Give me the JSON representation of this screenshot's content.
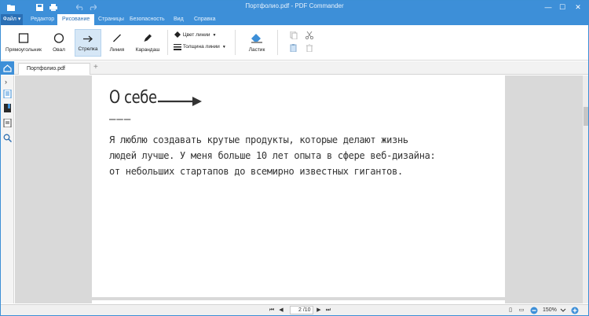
{
  "window": {
    "title": "Портфолио.pdf - PDF Commander",
    "accent": "#3d8fd8"
  },
  "menu": {
    "file": "Файл",
    "tabs": [
      "Редактор",
      "Рисование",
      "Страницы",
      "Безопасность",
      "Вид",
      "Справка"
    ],
    "active": "Рисование"
  },
  "ribbon": {
    "tools": [
      {
        "label": "Прямоугольник",
        "icon": "rectangle-icon"
      },
      {
        "label": "Овал",
        "icon": "oval-icon"
      },
      {
        "label": "Стрелка",
        "icon": "arrow-icon",
        "active": true
      },
      {
        "label": "Линия",
        "icon": "line-icon"
      },
      {
        "label": "Карандаш",
        "icon": "pencil-icon"
      }
    ],
    "line_color": "Цвет линии",
    "line_width": "Толщина линии",
    "eraser": "Ластик"
  },
  "doc_tab": {
    "name": "Портфолио.pdf"
  },
  "document": {
    "heading": "О себе",
    "dashes": "———",
    "lines": [
      "Я люблю создавать крутые продукты, которые делают жизнь",
      "людей лучше. У меня больше 10 лет опыта в сфере веб-дизайна:",
      "от небольших стартапов до всемирно известных гигантов."
    ]
  },
  "status": {
    "page": "2 /10",
    "zoom": "150%"
  }
}
